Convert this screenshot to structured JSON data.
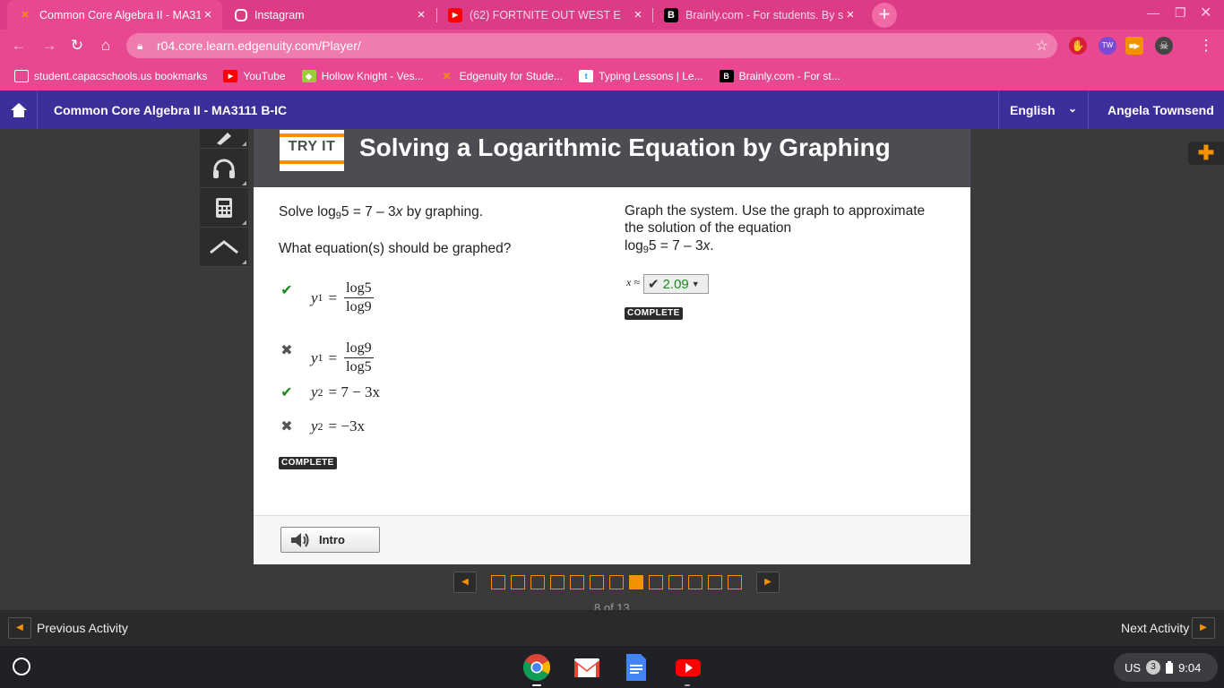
{
  "browser": {
    "tabs": [
      {
        "title": "Common Core Algebra II - MA31",
        "active": true,
        "icon": "edgenuity-x-icon"
      },
      {
        "title": "Instagram",
        "active": false,
        "icon": "instagram-icon"
      },
      {
        "title": "(62) FORTNITE OUT WEST E",
        "active": false,
        "icon": "youtube-icon"
      },
      {
        "title": "Brainly.com - For students. By st",
        "active": false,
        "icon": "brainly-icon"
      }
    ],
    "url": "r04.core.learn.edgenuity.com/Player/",
    "bookmarks": [
      {
        "label": "student.capacschools.us bookmarks",
        "icon": "folder-icon"
      },
      {
        "label": "YouTube",
        "icon": "youtube-icon"
      },
      {
        "label": "Hollow Knight - Ves...",
        "icon": "bookmark-icon"
      },
      {
        "label": "Edgenuity for Stude...",
        "icon": "edgenuity-x-icon"
      },
      {
        "label": "Typing Lessons | Le...",
        "icon": "typing-icon"
      },
      {
        "label": "Brainly.com - For st...",
        "icon": "brainly-icon"
      }
    ],
    "accent": "#e8488f"
  },
  "header": {
    "course": "Common Core Algebra II - MA3111 B-IC",
    "language": "English",
    "user": "Angela Townsend",
    "color": "#3d2f9a"
  },
  "activity": {
    "badge": "TRY IT",
    "title": "Solving a Logarithmic Equation by Graphing"
  },
  "left": {
    "prompt_pre": "Solve log",
    "prompt_sub": "9",
    "prompt_post": "5 = 7 – 3",
    "prompt_var": "x",
    "prompt_end": " by graphing.",
    "question": "What equation(s) should be graphed?",
    "options": [
      {
        "lhs": "y",
        "sub": "1",
        "num": "log5",
        "den": "log9",
        "status": "correct"
      },
      {
        "lhs": "y",
        "sub": "1",
        "num": "log9",
        "den": "log5",
        "status": "incorrect"
      },
      {
        "lhs": "y",
        "sub": "2",
        "rhs": "= 7 − 3x",
        "status": "correct"
      },
      {
        "lhs": "y",
        "sub": "2",
        "rhs": "= −3x",
        "status": "incorrect"
      }
    ],
    "complete": "COMPLETE"
  },
  "right": {
    "instruction": "Graph the system. Use the graph to approximate the solution of the equation",
    "eq_pre": "log",
    "eq_sub": "9",
    "eq_post": "5 = 7 – 3",
    "eq_var": "x",
    "eq_end": ".",
    "answer_label": "x ≈",
    "answer_value": "2.09",
    "complete": "COMPLETE"
  },
  "footer": {
    "intro": "Intro"
  },
  "pager": {
    "total": 13,
    "current": 8,
    "label": "8 of 13"
  },
  "nav": {
    "previous": "Previous Activity",
    "next": "Next Activity"
  },
  "shelf": {
    "locale": "US",
    "notifications": "3",
    "time": "9:04"
  }
}
